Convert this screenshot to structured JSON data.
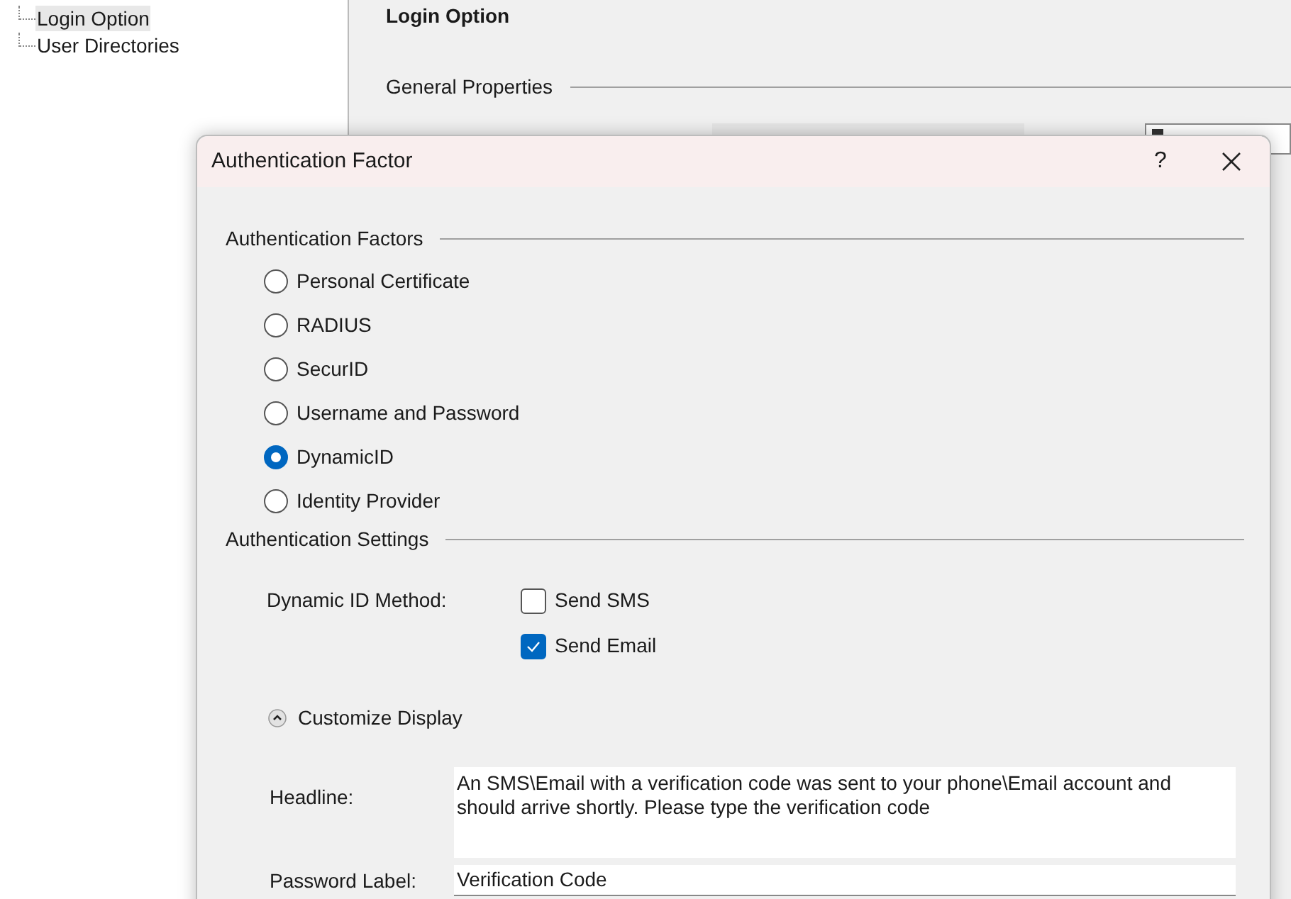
{
  "tree": {
    "items": [
      {
        "label": "Login Option",
        "selected": true
      },
      {
        "label": "User Directories",
        "selected": false
      }
    ]
  },
  "page": {
    "title": "Login Option",
    "section": "General Properties"
  },
  "dialog": {
    "title": "Authentication Factor",
    "help": "?",
    "factors_heading": "Authentication Factors",
    "factors": [
      {
        "label": "Personal Certificate",
        "selected": false
      },
      {
        "label": "RADIUS",
        "selected": false
      },
      {
        "label": "SecurID",
        "selected": false
      },
      {
        "label": "Username and Password",
        "selected": false
      },
      {
        "label": "DynamicID",
        "selected": true
      },
      {
        "label": "Identity Provider",
        "selected": false
      }
    ],
    "settings_heading": "Authentication Settings",
    "method_label": "Dynamic ID Method:",
    "methods": [
      {
        "label": "Send SMS",
        "checked": false
      },
      {
        "label": "Send Email",
        "checked": true
      }
    ],
    "customize": {
      "label": "Customize Display",
      "expanded": true
    },
    "headline_label": "Headline:",
    "headline_value": "An SMS\\Email with a verification code was sent to your phone\\Email account and should arrive shortly. Please type the verification code",
    "password_label": "Password Label:",
    "password_value": "Verification Code"
  }
}
